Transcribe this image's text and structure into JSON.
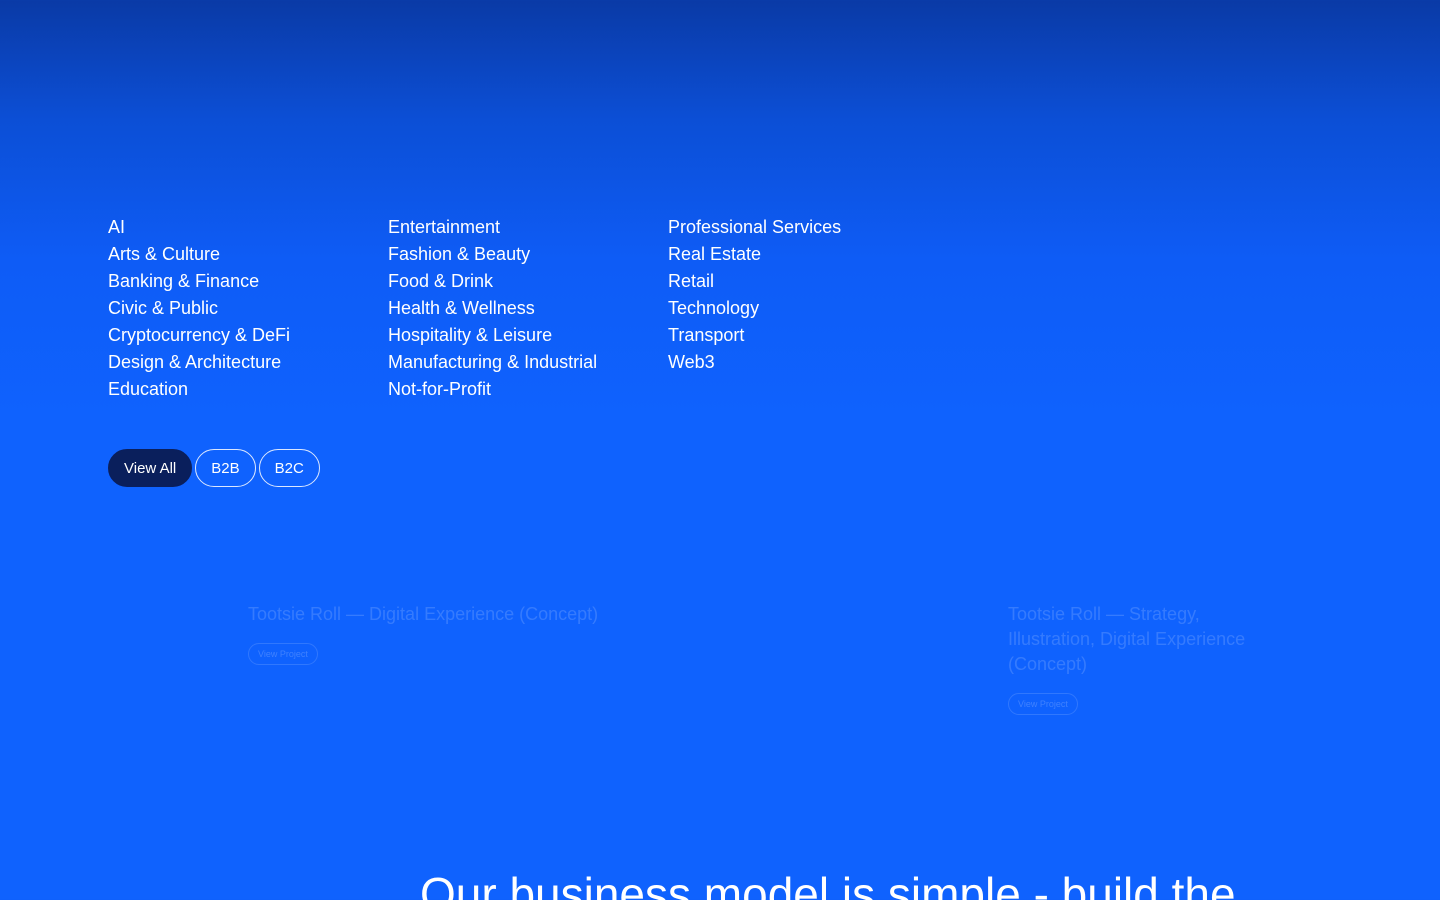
{
  "industries": {
    "columns": [
      [
        "AI",
        "Arts & Culture",
        "Banking & Finance",
        "Civic & Public",
        "Cryptocurrency & DeFi",
        "Design & Architecture",
        "Education"
      ],
      [
        "Entertainment",
        "Fashion & Beauty",
        "Food & Drink",
        "Health & Wellness",
        "Hospitality & Leisure",
        "Manufacturing & Industrial",
        "Not-for-Profit"
      ],
      [
        "Professional Services",
        "Real Estate",
        "Retail",
        "Technology",
        "Transport",
        "Web3"
      ]
    ]
  },
  "filters": {
    "view_all": "View All",
    "b2b": "B2B",
    "b2c": "B2C",
    "active": "View All"
  },
  "projects": [
    {
      "title": "Tootsie Roll — Digital Experience (Concept)",
      "button": "View Project"
    },
    {
      "title": "Tootsie Roll — Strategy, Illustration, Digital Experience (Concept)",
      "button": "View Project"
    }
  ],
  "tagline": "Our business model is simple - build the",
  "colors": {
    "accent": "#0f62fe",
    "active_pill": "#0a1f5c",
    "text": "#ffffff"
  }
}
